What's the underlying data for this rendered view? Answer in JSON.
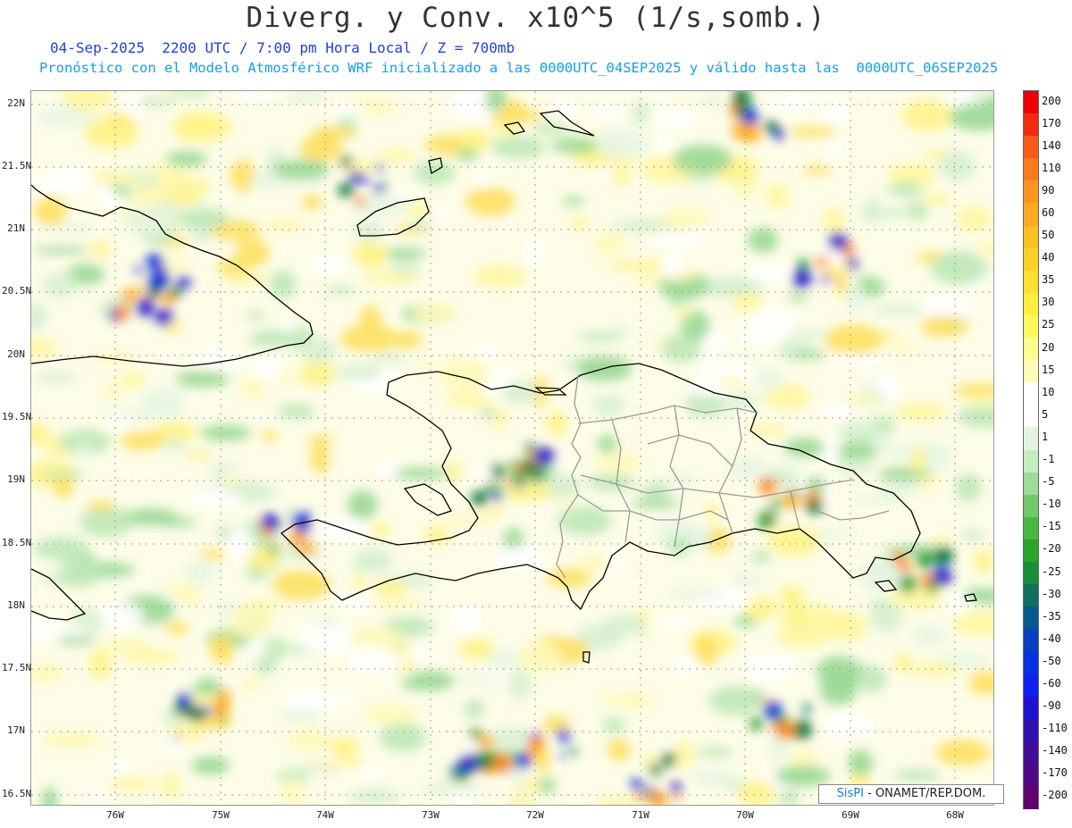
{
  "title": "Diverg. y Conv. x10^5 (1/s,somb.)",
  "subtitle_time": "04-Sep-2025  2200 UTC / 7:00 pm Hora Local / Z = 700mb",
  "subtitle_model": "Pronóstico con el Modelo Atmosférico WRF inicializado a las 0000UTC_04SEP2025 y válido hasta las  0000UTC_06SEP2025",
  "lat_labels": [
    "22N",
    "21.5N",
    "21N",
    "20.5N",
    "20N",
    "19.5N",
    "19N",
    "18.5N",
    "18N",
    "17.5N",
    "17N",
    "16.5N"
  ],
  "lon_labels": [
    "76W",
    "75W",
    "74W",
    "73W",
    "72W",
    "71W",
    "70W",
    "69W",
    "68W"
  ],
  "colorbar": {
    "labels": [
      "200",
      "170",
      "140",
      "110",
      "90",
      "60",
      "50",
      "40",
      "35",
      "30",
      "25",
      "20",
      "15",
      "10",
      "5",
      "1",
      "-1",
      "-5",
      "-10",
      "-15",
      "-20",
      "-25",
      "-30",
      "-35",
      "-40",
      "-50",
      "-60",
      "-90",
      "-110",
      "-140",
      "-170",
      "-200"
    ],
    "colors": [
      "#ee0000",
      "#f42a10",
      "#f85a18",
      "#fa7a1c",
      "#fc9420",
      "#fdaa22",
      "#fdc024",
      "#fdd028",
      "#fde030",
      "#fdee40",
      "#fef860",
      "#fefc90",
      "#fefcb8",
      "#ffffff",
      "#ffffff",
      "#e4f4e0",
      "#c4ecc0",
      "#9edc98",
      "#70c868",
      "#48b840",
      "#28a428",
      "#188e38",
      "#107060",
      "#085890",
      "#0840c0",
      "#0830e0",
      "#1020f0",
      "#2010d0",
      "#3010b0",
      "#400c98",
      "#500888",
      "#600070"
    ]
  },
  "credit": {
    "brand": "SisPI",
    "text": " - ONAMET/REP.DOM."
  }
}
